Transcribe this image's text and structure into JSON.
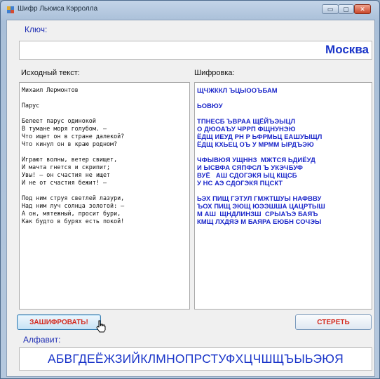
{
  "window": {
    "title": "Шифр Льюиса Кэрролла",
    "controls": {
      "minimize": "▭",
      "maximize": "▢",
      "close": "✕"
    }
  },
  "key": {
    "label": "Ключ:",
    "value": "Москва"
  },
  "source": {
    "label": "Исходный текст:",
    "text": "Михаил Лермонтов\n\nПарус\n\nБелеет парус одинокой\nВ тумане моря голубом. —\nЧто ищет он в стране далекой?\nЧто кинул он в краю родном?\n\nИграют волны, ветер свищет,\nИ мачта гнется и скрипит;\nУвы! — он счастия не ищет\nИ не от счастия бежит! —\n\nПод ним струя светлей лазури,\nНад ним луч солнца золотой: —\nА он, мятежный, просит бури,\nКак будто в бурях есть покой!"
  },
  "cipher": {
    "label": "Шифровка:",
    "text": "ЩЧЖККЛ ЪЦЫООЪБАМ\n\nЬОВЮУ\n\nТПНЕСБ ЪВРАА ЩЁЙЪЭЫЦЛ\nО ДЮОАЪУ ЧРРП ФЩНУНЭЮ\nЁДЩ ИЕУД РН Р ЬФРМЬЦ ЕАШУЫЩЛ\nЁДЩ КХЬЕЦ ОЪ У МРММ ЫРДЪЭЮ\n\nЧФЫВЮЯ УЩННЗ  МЖТСЯ ЬДИЁУД\nИ ЫСВФА СЯПФСЛ Ъ УКЭЧБУФ\nВУЁ   АШ СДОГЭКЯ ЫЦ КЩСБ\nУ НС АЭ СДОГЭКЯ ПЦСКТ\n\nЬЭХ ПИЩ ГЭТУЛ ГМЖТШУЫ НАФВВУ\nЪОХ ПИЩ ЭЮЩ ЮЭЭШША ЦАЦРТЫШ\nМ АШ  ЩНДЛИНЗШ  СРЫАЪЭ БАЯЪ\nКМЩ ЛХДЯЭ М БАЯРА ЕЮБН СОЧЭЫ"
  },
  "buttons": {
    "encrypt": "ЗАШИФРОВАТЬ!",
    "clear": "СТЕРЕТЬ"
  },
  "alphabet": {
    "label": "Алфавит:",
    "value": "АБВГДЕЁЖЗИЙКЛМНОПРСТУФХЦЧШЩЪЫЬЭЮЯ"
  },
  "colors": {
    "accent": "#1a35c9",
    "button_text": "#d42a1f"
  }
}
